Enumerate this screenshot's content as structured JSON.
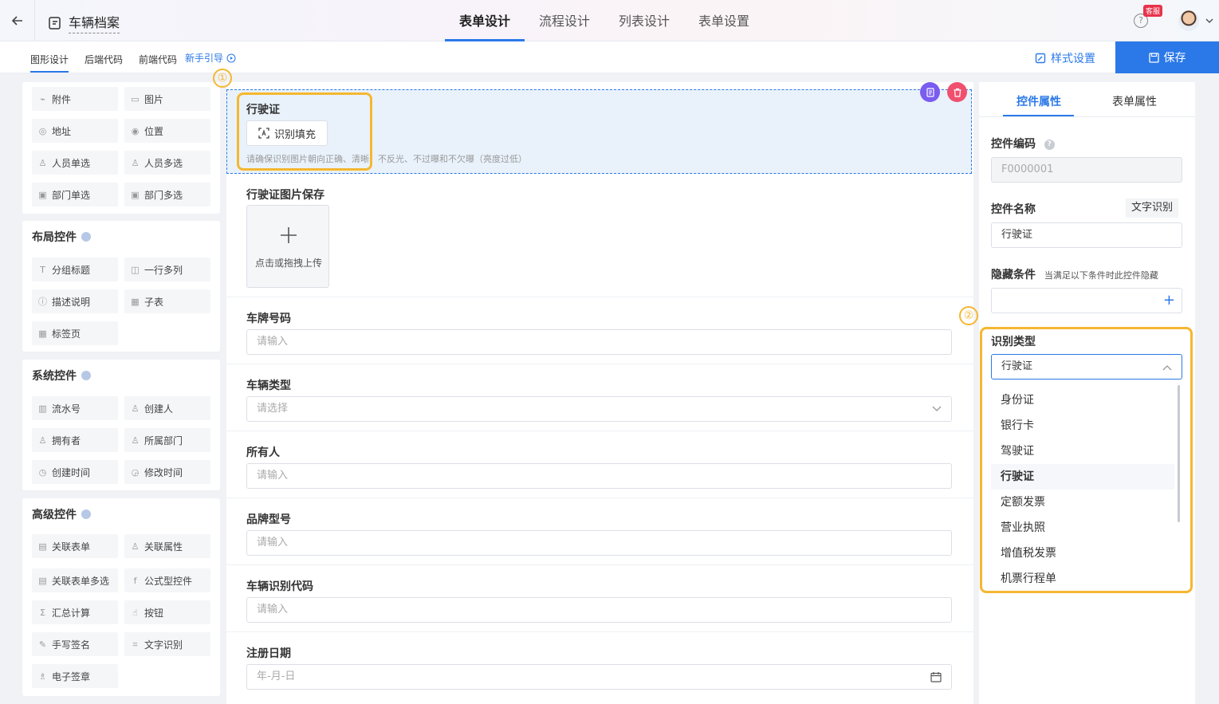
{
  "header": {
    "title": "车辆档案",
    "tabs": [
      "表单设计",
      "流程设计",
      "列表设计",
      "表单设置"
    ],
    "kefu": "客服",
    "help": "?"
  },
  "subbar": {
    "tabs": [
      "图形设计",
      "后端代码",
      "前端代码"
    ],
    "guide": "新手引导",
    "style": "样式设置",
    "save": "保存"
  },
  "palette": {
    "basic": [
      "附件",
      "图片",
      "地址",
      "位置",
      "人员单选",
      "人员多选",
      "部门单选",
      "部门多选"
    ],
    "layout_title": "布局控件",
    "layout": [
      "分组标题",
      "一行多列",
      "描述说明",
      "子表",
      "标签页"
    ],
    "system_title": "系统控件",
    "system": [
      "流水号",
      "创建人",
      "拥有者",
      "所属部门",
      "创建时间",
      "修改时间"
    ],
    "advanced_title": "高级控件",
    "advanced": [
      "关联表单",
      "关联属性",
      "关联表单多选",
      "公式型控件",
      "汇总计算",
      "按钮",
      "手写签名",
      "文字识别",
      "电子签章"
    ]
  },
  "canvas": {
    "ocr_label": "行驶证",
    "ocr_button": "识别填充",
    "ocr_hint": "请确保识别图片朝向正确、清晰、不反光、不过曝和不欠曝（亮度过低）",
    "upload_label": "行驶证图片保存",
    "upload_text": "点击或拖拽上传",
    "fields": [
      {
        "label": "车牌号码",
        "placeholder": "请输入"
      },
      {
        "label": "车辆类型",
        "placeholder": "请选择"
      },
      {
        "label": "所有人",
        "placeholder": "请输入"
      },
      {
        "label": "品牌型号",
        "placeholder": "请输入"
      },
      {
        "label": "车辆识别代码",
        "placeholder": "请输入"
      },
      {
        "label": "注册日期",
        "placeholder": "年-月-日"
      }
    ]
  },
  "annotations": {
    "one": "①",
    "two": "②"
  },
  "props": {
    "tabs": [
      "控件属性",
      "表单属性"
    ],
    "code_label": "控件编码",
    "code_value": "F0000001",
    "name_label": "控件名称",
    "name_tag": "文字识别",
    "name_value": "行驶证",
    "hide_label": "隐藏条件",
    "hide_hint": "当满足以下条件时此控件隐藏",
    "type_label": "识别类型",
    "type_value": "行驶证",
    "options": [
      "身份证",
      "银行卡",
      "驾驶证",
      "行驶证",
      "定额发票",
      "营业执照",
      "增值税发票",
      "机票行程单"
    ]
  },
  "colors": {
    "accent": "#2b79e8",
    "highlight": "#f5b731",
    "delete": "#f0506e",
    "copy": "#7a5cf0"
  }
}
